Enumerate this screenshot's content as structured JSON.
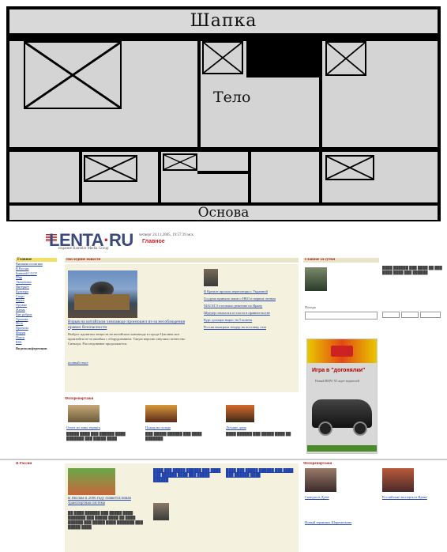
{
  "wireframe": {
    "header_label": "Шапка",
    "body_label": "Тело",
    "footer_label": "Основа"
  },
  "site": {
    "logo": "LENTA",
    "logo_dot": "·",
    "logo_tld": "RU",
    "subtitle": "издание Rambler Media Group",
    "date": "четверг 24.11.2005, 19:57:39 мск",
    "section": "Главное",
    "sidebar_title": "Главное",
    "sidebar_items": [
      "Внешняя политика",
      "В России",
      "Бывший СССР",
      "Мир",
      "Экономика",
      "Интернет",
      "Культура",
      "Спорт",
      "Наука",
      "Оружие",
      "Жизнь",
      "Вне рубрик",
      "Хроника",
      "Фото",
      "Проекты",
      "Форум",
      "Поиск",
      "RSS"
    ],
    "sidebar_more": "Видеоконференции",
    "news_heading": "Последние новости",
    "headline": "Взрыв на китайском химзаводе произошел из-за несоблюдения правил безопасности",
    "lead": "Выброс ядовитых веществ на китайском химзаводе в городе Цзилинь мог произойти из-за ошибки с оборудованием. Такую версию озвучило агентство Синьхуа. Расследование продолжается.",
    "lead_link": "полный текст",
    "right_heading": "Главное за сутки",
    "weather_label": "Погода",
    "promo_text": "Игра в \"догонялки\"",
    "promo_sub": "Новый BMW X5 ждет водителей",
    "photo_heading": "Фоторепортажи",
    "photo_captions": [
      "Отчет из зоны теракта",
      "Пожар на складе",
      "Лучшие дома"
    ],
    "russia_heading": "В России",
    "bottom_headline": "В Москве в 2006 году появится новая транспортная система",
    "bottom_right_heading": "Фоторепортажи",
    "bottom_right_links": [
      "Скандал в Думе",
      "Российские эксперты в Ираке",
      "Новый терминал Шереметьево"
    ],
    "news_items": [
      "В Кремле прошли переговоры с Украиной",
      "Госдума приняла закон о НКО в первом чтении",
      "МАГАТЭ отложило решение по Ирану",
      "Шредер отказался от поста в правительстве",
      "Курс доллара вырос на 5 копеек",
      "Россия выиграла тендер на поставку газа"
    ]
  }
}
